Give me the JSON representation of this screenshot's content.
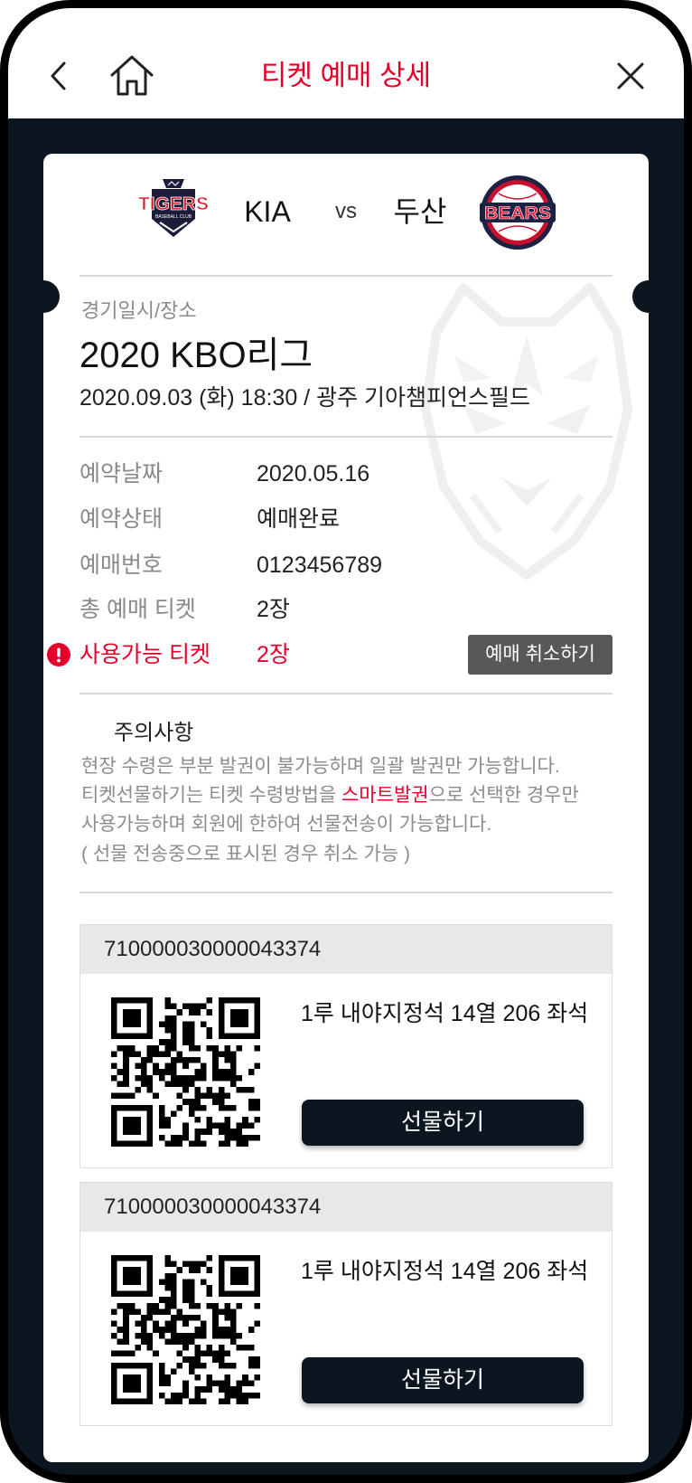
{
  "header": {
    "title": "티켓 예매 상세",
    "back_icon": "chevron-left-icon",
    "home_icon": "home-icon",
    "close_icon": "close-icon"
  },
  "match": {
    "home_team": "KIA",
    "versus": "vs",
    "away_team": "두산",
    "home_logo": {
      "icon": "tigers-logo",
      "text": "TIGERS",
      "subtext": "BASEBALL CLUB"
    },
    "away_logo": {
      "icon": "bears-logo",
      "text": "BEARS"
    }
  },
  "game": {
    "label": "경기일시/장소",
    "league": "2020 KBO리그",
    "datetime_venue": "2020.09.03 (화) 18:30 / 광주 기아챔피언스필드"
  },
  "reservation": {
    "rows": [
      {
        "label": "예약날짜",
        "value": "2020.05.16"
      },
      {
        "label": "예약상태",
        "value": "예매완료"
      },
      {
        "label": "예매번호",
        "value": "0123456789"
      },
      {
        "label": "총 예매 티켓",
        "value": "2장"
      }
    ],
    "available": {
      "icon": "alert-icon",
      "label": "사용가능 티켓",
      "value": "2장"
    },
    "cancel_button": "예매 취소하기"
  },
  "notice": {
    "title": "주의사항",
    "line1": "현장 수령은 부분 발권이 불가능하며 일괄 발권만 가능합니다.",
    "line2_before": "티켓선물하기는 티켓 수령방법을 ",
    "line2_highlight": "스마트발권",
    "line2_after": "으로 선택한 경우만",
    "line3": "사용가능하며 회원에 한하여 선물전송이 가능합니다.",
    "line4": "( 선물 전송중으로 표시된 경우 취소 가능 )"
  },
  "tickets": [
    {
      "number": "710000030000043374",
      "qr_icon": "qr-code",
      "seat": "1루 내야지정석 14열 206 좌석",
      "gift_button": "선물하기"
    },
    {
      "number": "710000030000043374",
      "qr_icon": "qr-code",
      "seat": "1루 내야지정석 14열 206 좌석",
      "gift_button": "선물하기"
    }
  ],
  "colors": {
    "accent_red": "#e4002b",
    "navy": "#0c1621",
    "cancel_gray": "#585858",
    "tab_band_gray": "#e8e8e8"
  }
}
